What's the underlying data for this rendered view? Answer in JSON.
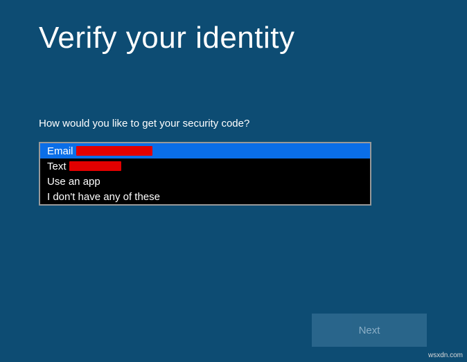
{
  "page": {
    "title": "Verify your identity",
    "prompt": "How would you like to get your security code?"
  },
  "options": [
    {
      "label": "Email",
      "redacted": true,
      "redaction_size": "wide",
      "selected": true
    },
    {
      "label": "Text",
      "redacted": true,
      "redaction_size": "narrow",
      "selected": false
    },
    {
      "label": "Use an app",
      "redacted": false,
      "selected": false
    },
    {
      "label": "I don't have any of these",
      "redacted": false,
      "selected": false
    }
  ],
  "buttons": {
    "next": "Next"
  },
  "watermark": "wsxdn.com"
}
